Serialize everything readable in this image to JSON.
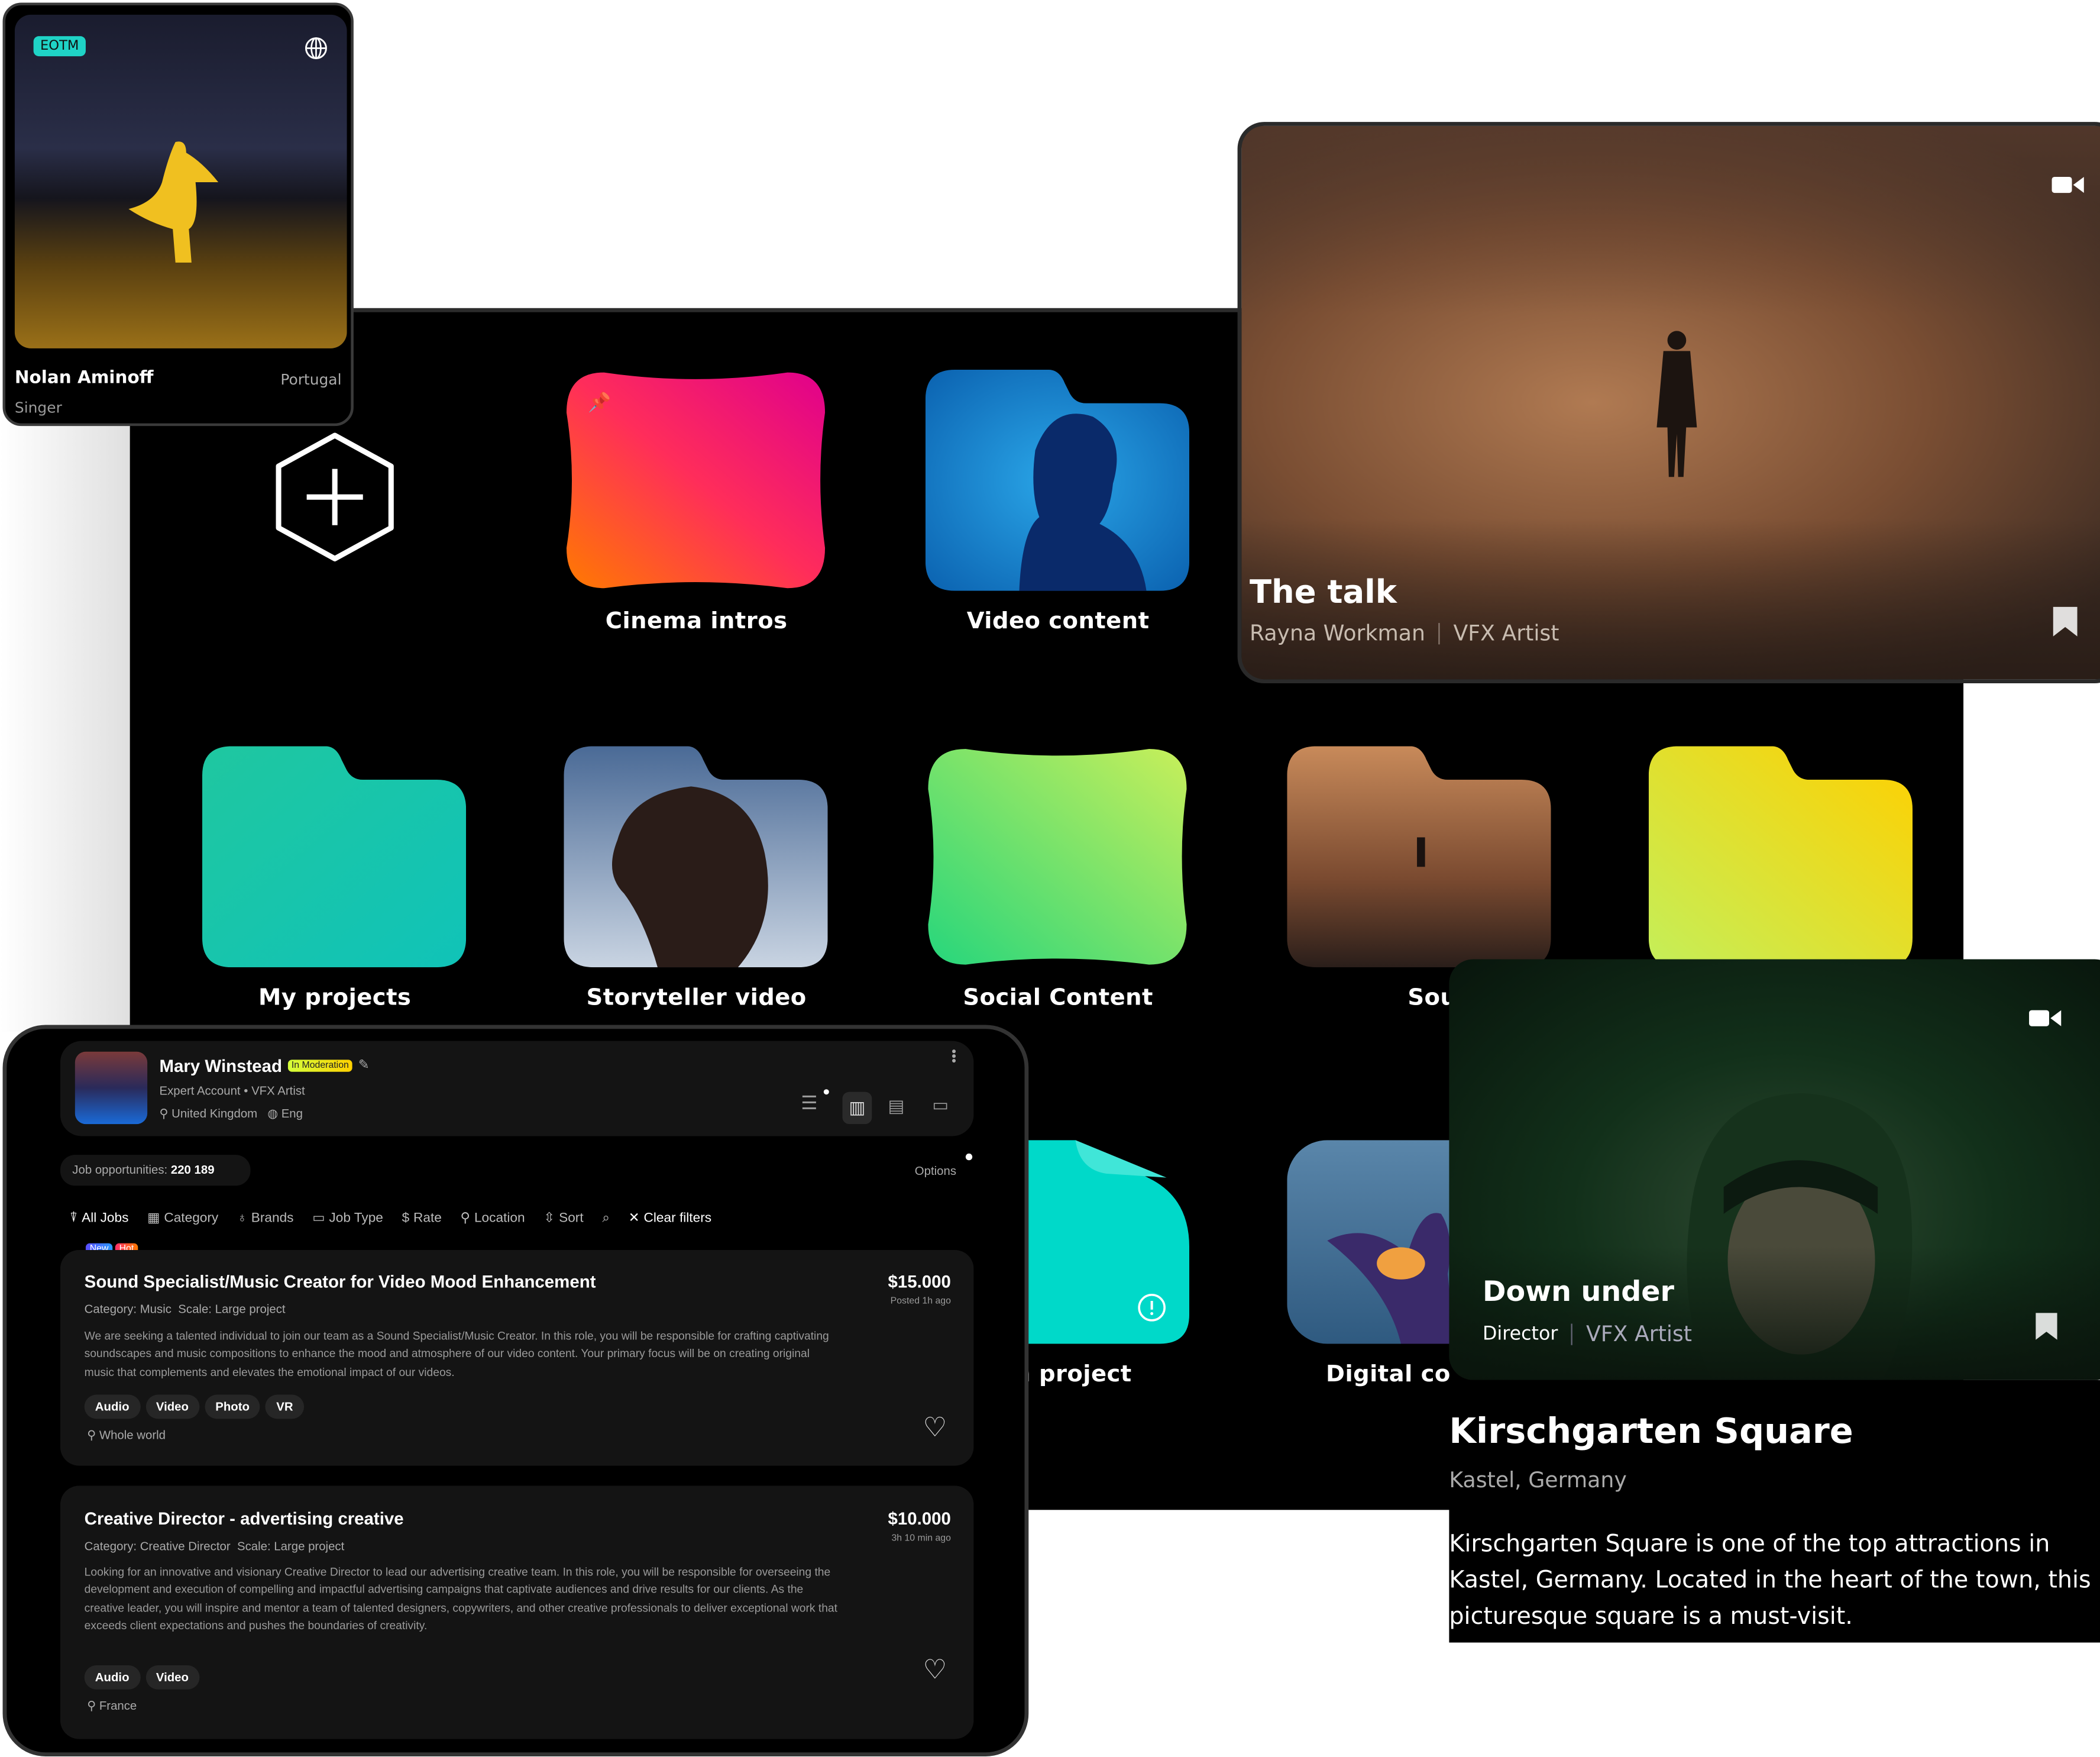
{
  "profile_card": {
    "badge": "EOTM",
    "name": "Nolan Aminoff",
    "country": "Portugal",
    "role": "Singer",
    "badge_color": "#1fd3c6"
  },
  "folders": [
    {
      "label": "Cinema intros"
    },
    {
      "label": "Video content"
    },
    {
      "label": "My projects"
    },
    {
      "label": "Storyteller video"
    },
    {
      "label": "Social Content"
    },
    {
      "label": "Soun"
    },
    {
      "label": ""
    },
    {
      "label": "n project"
    },
    {
      "label": "Digital co"
    }
  ],
  "talk_card": {
    "title": "The talk",
    "author": "Rayna Workman",
    "role": "VFX Artist"
  },
  "down_card": {
    "title": "Down under",
    "role1": "Director",
    "role2": "VFX Artist"
  },
  "place": {
    "title": "Kirschgarten Square",
    "location": "Kastel, Germany",
    "description": "Kirschgarten Square is one of the top attractions in Kastel, Germany. Located in the heart of the town, this picturesque square is a must-visit."
  },
  "jobs_panel": {
    "user": {
      "name": "Mary Winstead",
      "status": "In Moderation",
      "account": "Expert Account",
      "role": "VFX Artist",
      "country": "United Kingdom",
      "language": "Eng"
    },
    "opportunities_label": "Job opportunities:",
    "opportunities_count": "220 189",
    "options_label": "Options",
    "filters": [
      "All Jobs",
      "Category",
      "Brands",
      "Job Type",
      "Rate",
      "Location",
      "Sort"
    ],
    "clear_filters": "Clear filters",
    "badges": {
      "new": "New",
      "hot": "Hot"
    },
    "jobs": [
      {
        "title": "Sound Specialist/Music Creator for Video Mood Enhancement",
        "price": "$15.000",
        "posted": "Posted 1h ago",
        "category": "Category: Music",
        "scale": "Scale: Large project",
        "description": "We are seeking a talented individual to join our team as a Sound Specialist/Music Creator. In this role, you will be responsible for crafting captivating soundscapes and music compositions to enhance the mood and atmosphere of our video content. Your primary focus will be on creating original music that complements and elevates the emotional impact of our videos.",
        "tags": [
          "Audio",
          "Video",
          "Photo",
          "VR"
        ],
        "location": "Whole world"
      },
      {
        "title": "Creative Director - advertising creative",
        "price": "$10.000",
        "posted": "3h 10 min ago",
        "category": "Category: Creative Director",
        "scale": "Scale: Large project",
        "description": "Looking for an innovative and visionary Creative Director to lead our advertising creative team. In this role, you will be responsible for overseeing the development and execution of compelling and impactful advertising campaigns that captivate audiences and drive results for our clients. As the creative leader, you will inspire and mentor a team of talented designers, copywriters, and other creative professionals to deliver exceptional work that exceeds client expectations and pushes the boundaries of creativity.",
        "tags": [
          "Audio",
          "Video"
        ],
        "location": "France"
      }
    ]
  }
}
